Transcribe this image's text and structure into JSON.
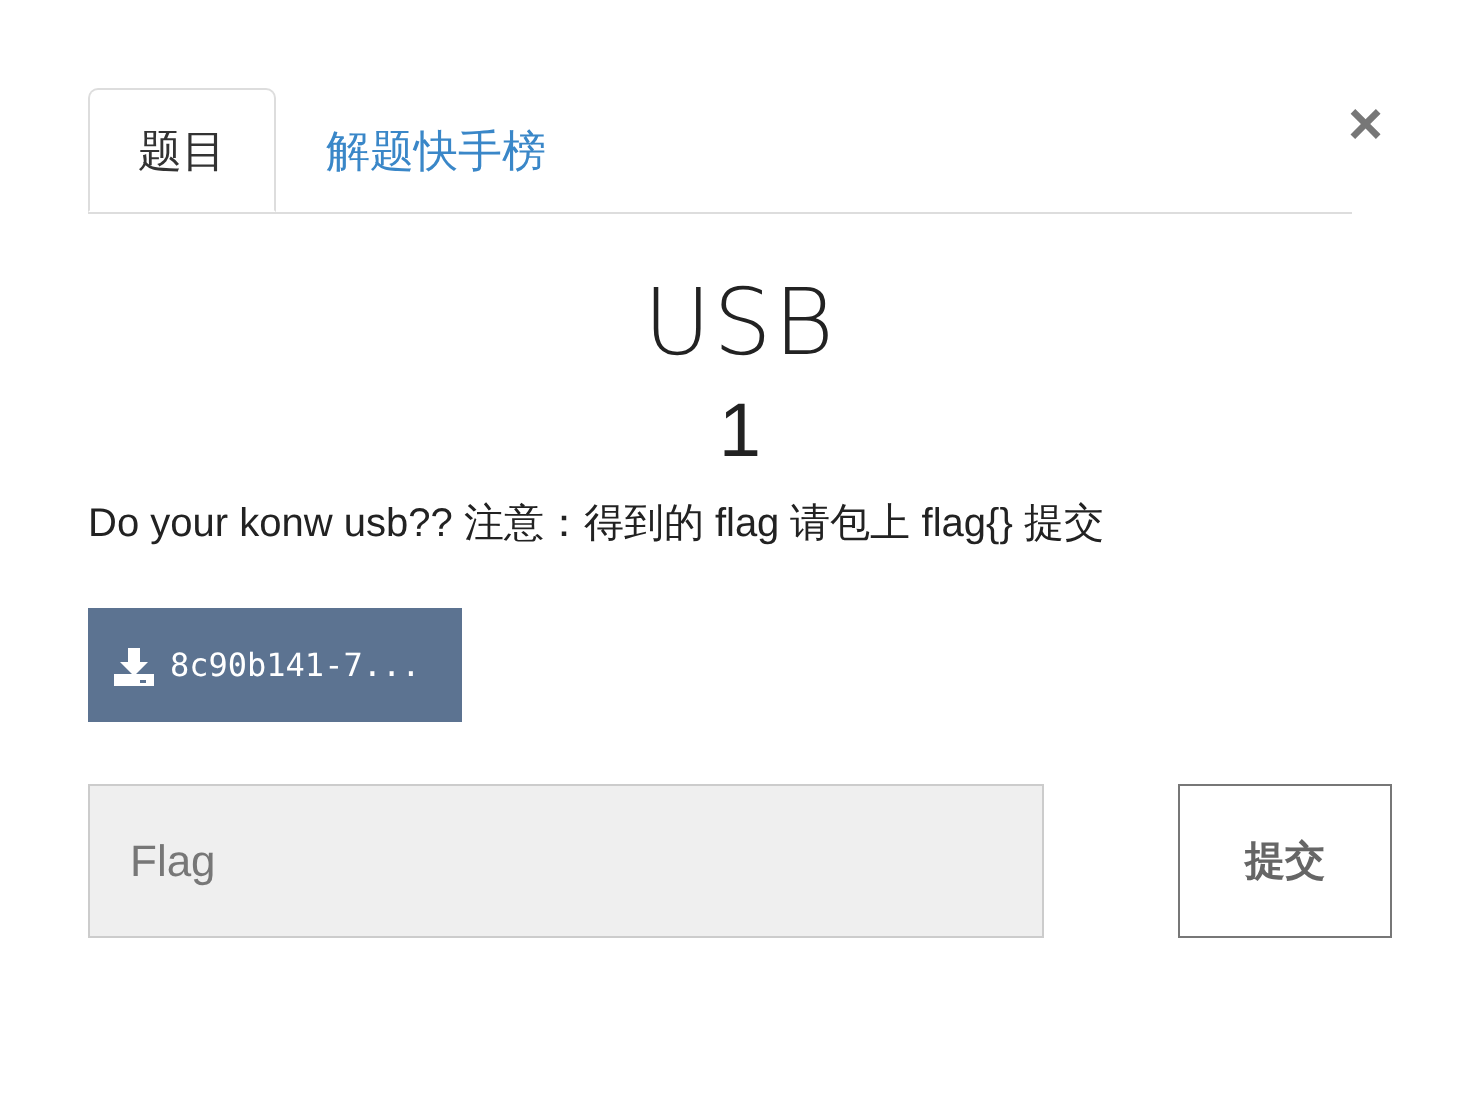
{
  "tabs": [
    {
      "label": "题目",
      "selected": true
    },
    {
      "label": "解题快手榜",
      "selected": false
    }
  ],
  "close": {
    "label": "×"
  },
  "challenge": {
    "title": "USB",
    "points": "1",
    "description": "Do your konw usb?? 注意：得到的 flag 请包上 flag{} 提交"
  },
  "file_button": {
    "label": "8c90b141-7..."
  },
  "flag_field": {
    "placeholder": "Flag"
  },
  "submit_button": {
    "label": "提交"
  }
}
